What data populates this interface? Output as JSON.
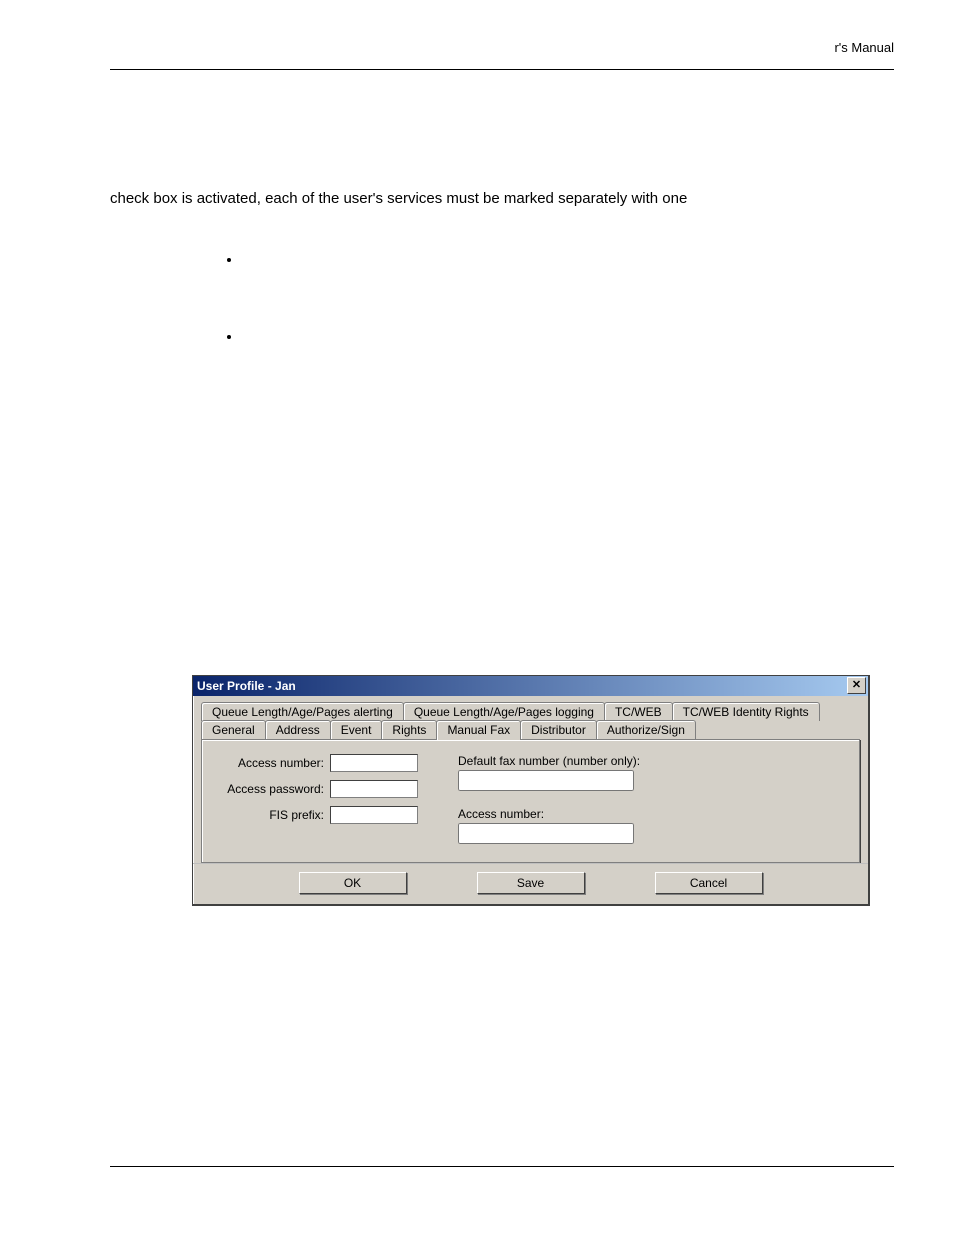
{
  "header": {
    "right_text": "r's Manual"
  },
  "paragraph": "check box is activated, each of the user's services must be marked separately with one",
  "bullets": [
    "",
    ""
  ],
  "dialog": {
    "title": "User Profile - Jan",
    "close_glyph": "✕",
    "tabs_row1": [
      "Queue Length/Age/Pages alerting",
      "Queue Length/Age/Pages logging",
      "TC/WEB",
      "TC/WEB Identity Rights"
    ],
    "tabs_row2": [
      "General",
      "Address",
      "Event",
      "Rights",
      "Manual Fax",
      "Distributor",
      "Authorize/Sign"
    ],
    "active_tab": "Manual Fax",
    "fields_left": {
      "access_number_label": "Access number:",
      "access_number_value": "",
      "access_password_label": "Access password:",
      "access_password_value": "",
      "fis_prefix_label": "FIS prefix:",
      "fis_prefix_value": ""
    },
    "fields_right": {
      "default_fax_label": "Default fax number (number only):",
      "default_fax_value": "",
      "access_number2_label": "Access number:",
      "access_number2_value": ""
    },
    "buttons": {
      "ok": "OK",
      "save": "Save",
      "cancel": "Cancel"
    }
  }
}
